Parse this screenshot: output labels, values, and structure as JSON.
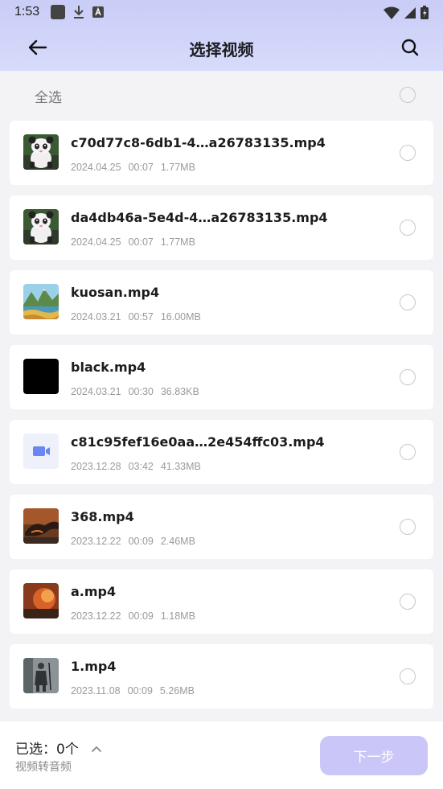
{
  "status_bar": {
    "time": "1:53"
  },
  "header": {
    "title": "选择视频"
  },
  "select_all": {
    "label": "全选"
  },
  "videos": [
    {
      "name": "c70d77c8-6db1-4…a26783135.mp4",
      "date": "2024.04.25",
      "duration": "00:07",
      "size": "1.77MB",
      "thumb": "panda-icon"
    },
    {
      "name": "da4db46a-5e4d-4…a26783135.mp4",
      "date": "2024.04.25",
      "duration": "00:07",
      "size": "1.77MB",
      "thumb": "panda-icon"
    },
    {
      "name": "kuosan.mp4",
      "date": "2024.03.21",
      "duration": "00:57",
      "size": "16.00MB",
      "thumb": "landscape-thumbnail"
    },
    {
      "name": "black.mp4",
      "date": "2024.03.21",
      "duration": "00:30",
      "size": "36.83KB",
      "thumb": "black-thumbnail"
    },
    {
      "name": "c81c95fef16e0aa…2e454ffc03.mp4",
      "date": "2023.12.28",
      "duration": "03:42",
      "size": "41.33MB",
      "thumb": "video-camera-icon"
    },
    {
      "name": "368.mp4",
      "date": "2023.12.22",
      "duration": "00:09",
      "size": "2.46MB",
      "thumb": "dragon-thumbnail"
    },
    {
      "name": "a.mp4",
      "date": "2023.12.22",
      "duration": "00:09",
      "size": "1.18MB",
      "thumb": "explosion-thumbnail"
    },
    {
      "name": "1.mp4",
      "date": "2023.11.08",
      "duration": "00:09",
      "size": "5.26MB",
      "thumb": "warrior-thumbnail"
    }
  ],
  "bottom_bar": {
    "selected_label": "已选：0个",
    "subtitle": "视频转音频",
    "next_label": "下一步"
  },
  "colors": {
    "header_bg": "#c9cdf7",
    "next_button_bg": "#cbc6f8",
    "camera_icon": "#6a86f2"
  }
}
